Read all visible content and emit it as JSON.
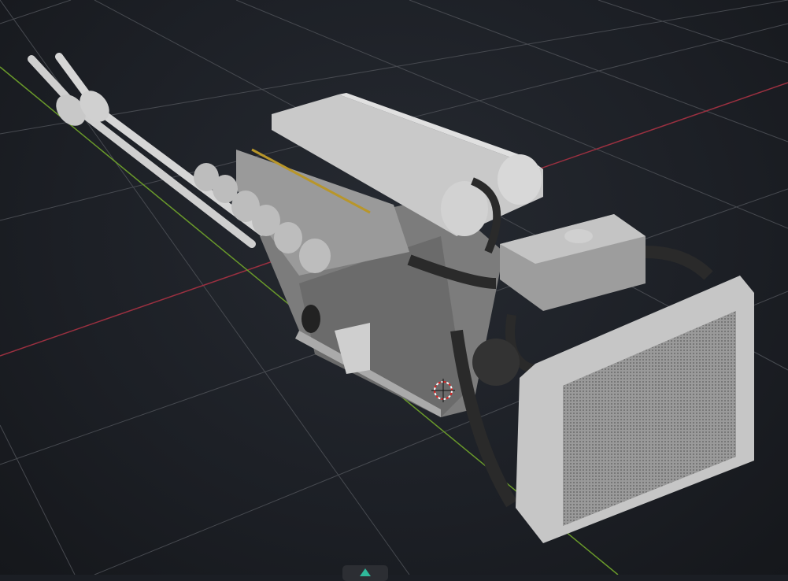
{
  "viewport": {
    "background_color": "#1c1f25",
    "grid_color": "#4a4d53",
    "x_axis_color": "#9b3040",
    "y_axis_color": "#6a9a2a",
    "model_color": "#b8b8b8",
    "hose_color": "#2a2a2a"
  },
  "icons": {
    "cursor": "3d-cursor-icon",
    "navigation": "navigation-gizmo-icon"
  }
}
